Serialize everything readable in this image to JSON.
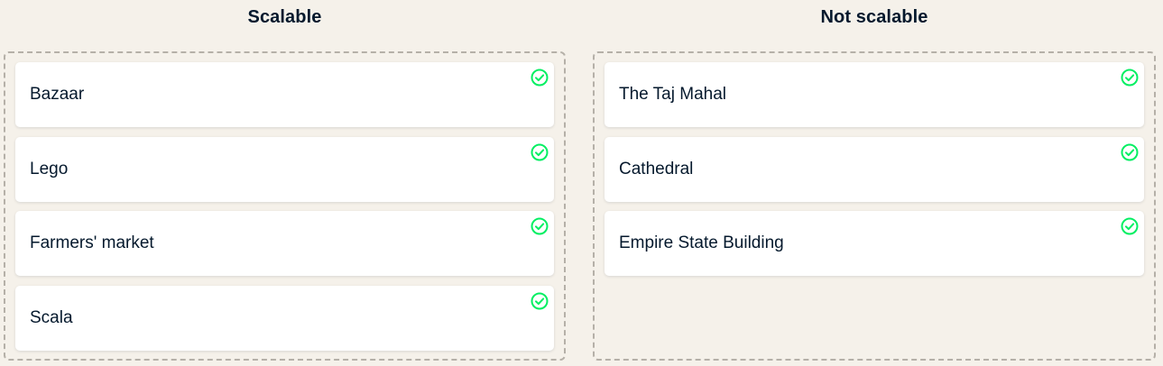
{
  "accent_color": "#03ef62",
  "columns": [
    {
      "title": "Scalable",
      "items": [
        {
          "label": "Bazaar",
          "status_icon": "check-circle-icon"
        },
        {
          "label": "Lego",
          "status_icon": "check-circle-icon"
        },
        {
          "label": "Farmers' market",
          "status_icon": "check-circle-icon"
        },
        {
          "label": "Scala",
          "status_icon": "check-circle-icon"
        }
      ]
    },
    {
      "title": "Not scalable",
      "items": [
        {
          "label": "The Taj Mahal",
          "status_icon": "check-circle-icon"
        },
        {
          "label": "Cathedral",
          "status_icon": "check-circle-icon"
        },
        {
          "label": "Empire State Building",
          "status_icon": "check-circle-icon"
        }
      ]
    }
  ]
}
